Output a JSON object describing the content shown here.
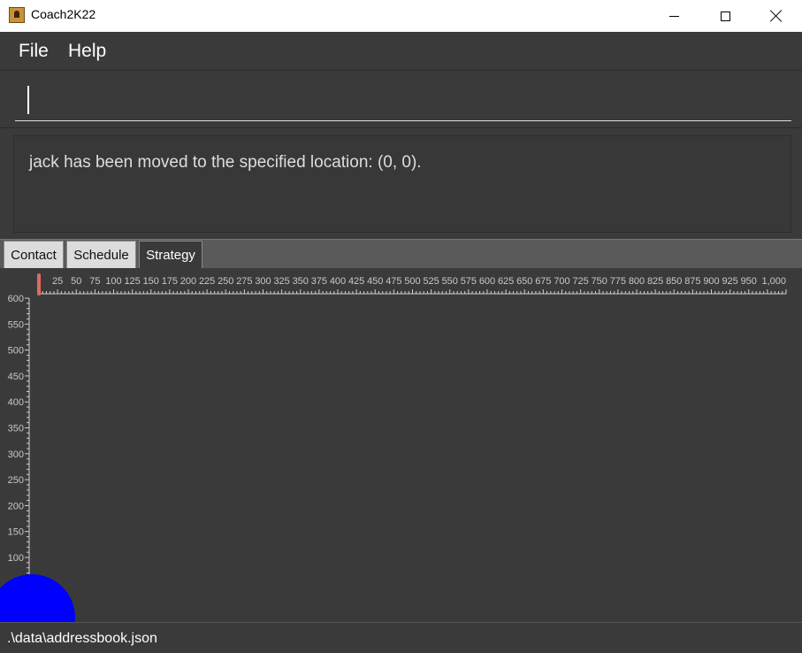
{
  "window": {
    "title": "Coach2K22"
  },
  "menu": {
    "items": [
      "File",
      "Help"
    ]
  },
  "command": {
    "value": "",
    "placeholder": ""
  },
  "result": {
    "text": "jack has been moved to the specified location: (0, 0)."
  },
  "tabs": [
    {
      "label": "Contact",
      "selected": false
    },
    {
      "label": "Schedule",
      "selected": false
    },
    {
      "label": "Strategy",
      "selected": true
    }
  ],
  "strategy": {
    "x_axis": {
      "min": 0,
      "max": 1000,
      "major_step": 25,
      "minor_step": 5,
      "labels": [
        "25",
        "50",
        "75",
        "100",
        "125",
        "150",
        "175",
        "200",
        "225",
        "250",
        "275",
        "300",
        "325",
        "350",
        "375",
        "400",
        "425",
        "450",
        "475",
        "500",
        "525",
        "550",
        "575",
        "600",
        "625",
        "650",
        "675",
        "700",
        "725",
        "750",
        "775",
        "800",
        "825",
        "850",
        "875",
        "900",
        "925",
        "950",
        "1,000"
      ]
    },
    "y_axis": {
      "visible_min": 100,
      "visible_max": 600,
      "major_step": 50,
      "minor_step": 10,
      "labels": [
        "600",
        "550",
        "500",
        "450",
        "400",
        "350",
        "300",
        "250",
        "200",
        "150",
        "100"
      ]
    },
    "player": {
      "name": "jack",
      "x": 0,
      "y": 0,
      "color": "#0000ff"
    },
    "scroll_thumb_color": "#e06a60"
  },
  "status": {
    "path": ".\\data\\addressbook.json"
  }
}
